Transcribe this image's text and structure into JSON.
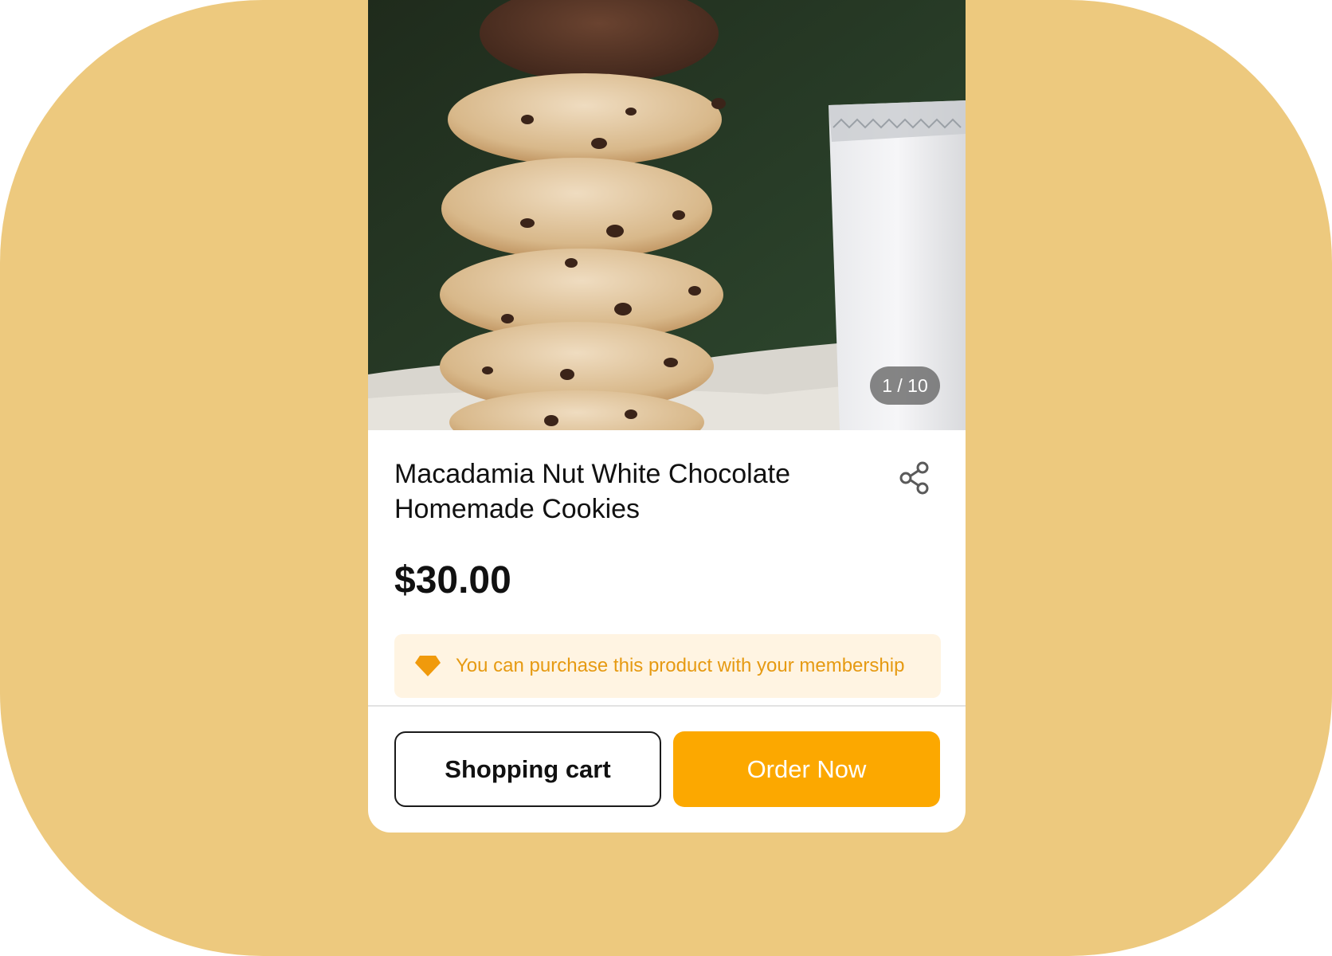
{
  "colors": {
    "background": "#EDC97E",
    "card": "#FFFFFF",
    "accent": "#FCA800",
    "membership_text": "#E69A12",
    "membership_bg": "#FFF4E2"
  },
  "gallery": {
    "counter": "1 / 10",
    "current": 1,
    "total": 10
  },
  "product": {
    "title": "Macadamia Nut White Chocolate Homemade Cookies",
    "price": "$30.00",
    "share_icon": "share-icon"
  },
  "membership": {
    "icon": "diamond-icon",
    "message": "You can purchase this product with your membership"
  },
  "actions": {
    "cart_label": "Shopping cart",
    "order_label": "Order Now"
  }
}
